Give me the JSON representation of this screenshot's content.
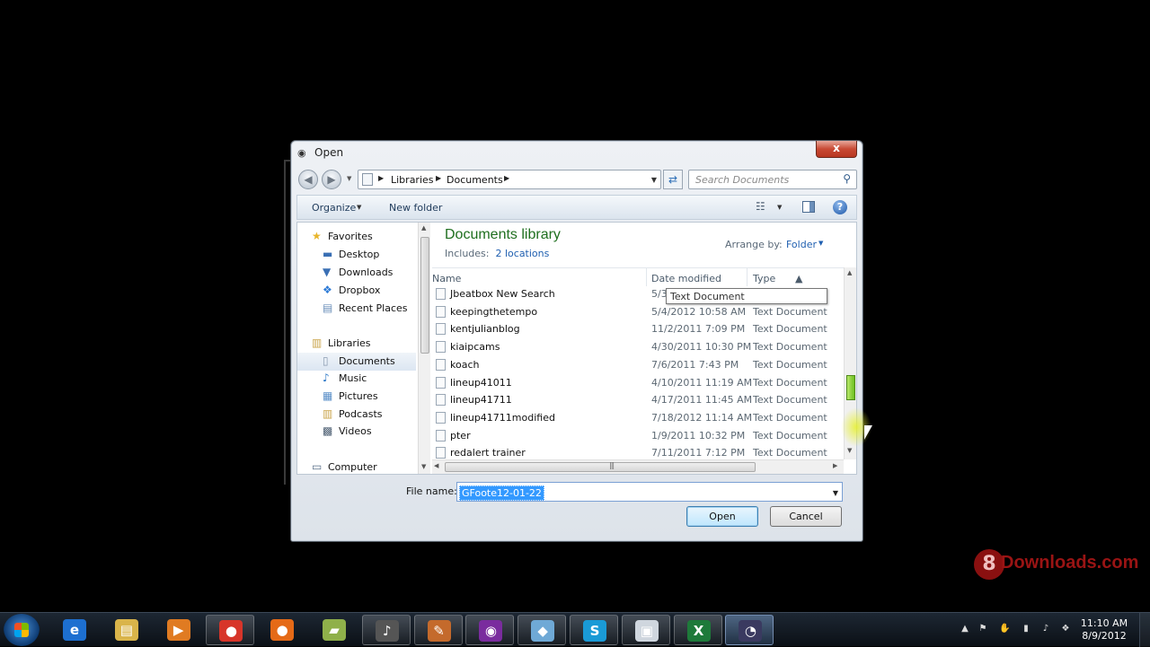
{
  "dialog": {
    "title": "Open",
    "close_label": "x",
    "nav": {
      "back_icon": "back-arrow-icon",
      "forward_icon": "forward-arrow-icon",
      "breadcrumb": [
        "Libraries",
        "Documents"
      ],
      "search_placeholder": "Search Documents"
    },
    "toolbar": {
      "organize_label": "Organize",
      "new_folder_label": "New folder"
    },
    "navpane": {
      "items": [
        {
          "label": "Favorites",
          "icon": "star-icon",
          "indent": 0,
          "selected": false
        },
        {
          "label": "Desktop",
          "icon": "desktop-icon",
          "indent": 1,
          "selected": false
        },
        {
          "label": "Downloads",
          "icon": "downloads-icon",
          "indent": 1,
          "selected": false
        },
        {
          "label": "Dropbox",
          "icon": "dropbox-icon",
          "indent": 1,
          "selected": false
        },
        {
          "label": "Recent Places",
          "icon": "recent-places-icon",
          "indent": 1,
          "selected": false
        },
        {
          "label": "Libraries",
          "icon": "libraries-icon",
          "indent": 0,
          "selected": false
        },
        {
          "label": "Documents",
          "icon": "documents-icon",
          "indent": 1,
          "selected": true
        },
        {
          "label": "Music",
          "icon": "music-icon",
          "indent": 1,
          "selected": false
        },
        {
          "label": "Pictures",
          "icon": "pictures-icon",
          "indent": 1,
          "selected": false
        },
        {
          "label": "Podcasts",
          "icon": "podcasts-icon",
          "indent": 1,
          "selected": false
        },
        {
          "label": "Videos",
          "icon": "videos-icon",
          "indent": 1,
          "selected": false
        },
        {
          "label": "Computer",
          "icon": "computer-icon",
          "indent": 0,
          "selected": false
        }
      ]
    },
    "library": {
      "title": "Documents library",
      "includes_label": "Includes:",
      "includes_link": "2 locations",
      "arrange_label": "Arrange by:",
      "arrange_value": "Folder"
    },
    "columns": {
      "name": "Name",
      "date": "Date modified",
      "type": "Type"
    },
    "files": [
      {
        "name": "Jbeatbox New Search",
        "date": "5/3",
        "type": ""
      },
      {
        "name": "keepingthetempo",
        "date": "5/4/2012 10:58 AM",
        "type": "Text Document"
      },
      {
        "name": "kentjulianblog",
        "date": "11/2/2011 7:09 PM",
        "type": "Text Document"
      },
      {
        "name": "kiaipcams",
        "date": "4/30/2011 10:30 PM",
        "type": "Text Document"
      },
      {
        "name": "koach",
        "date": "7/6/2011 7:43 PM",
        "type": "Text Document"
      },
      {
        "name": "lineup41011",
        "date": "4/10/2011 11:19 AM",
        "type": "Text Document"
      },
      {
        "name": "lineup41711",
        "date": "4/17/2011 11:45 AM",
        "type": "Text Document"
      },
      {
        "name": "lineup41711modified",
        "date": "7/18/2012 11:14 AM",
        "type": "Text Document"
      },
      {
        "name": "pter",
        "date": "1/9/2011 10:32 PM",
        "type": "Text Document"
      },
      {
        "name": "redalert trainer",
        "date": "7/11/2011 7:12 PM",
        "type": "Text Document"
      }
    ],
    "tooltip": "Text Document",
    "filename_label": "File name:",
    "filename_value": "GFoote12-01-22",
    "open_label": "Open",
    "cancel_label": "Cancel"
  },
  "watermark": {
    "digit": "8",
    "text": "Downloads.com"
  },
  "taskbar": {
    "apps": [
      {
        "name": "internet-explorer",
        "glyph": "e",
        "color": "#1d6fd0",
        "state": "none"
      },
      {
        "name": "windows-explorer",
        "glyph": "▤",
        "color": "#d9b44a",
        "state": "none"
      },
      {
        "name": "media-player",
        "glyph": "▶",
        "color": "#e07b22",
        "state": "none"
      },
      {
        "name": "chrome",
        "glyph": "●",
        "color": "#d7352a",
        "state": "open"
      },
      {
        "name": "firefox",
        "glyph": "●",
        "color": "#e56a17",
        "state": "none"
      },
      {
        "name": "notes-app",
        "glyph": "▰",
        "color": "#8fb04a",
        "state": "none"
      },
      {
        "name": "media-app",
        "glyph": "♪",
        "color": "#555",
        "state": "open"
      },
      {
        "name": "editor-app",
        "glyph": "✎",
        "color": "#c46a2c",
        "state": "open"
      },
      {
        "name": "torrent-app",
        "glyph": "◉",
        "color": "#7a2c9e",
        "state": "open"
      },
      {
        "name": "file-app",
        "glyph": "◆",
        "color": "#6fa9d6",
        "state": "open"
      },
      {
        "name": "skype",
        "glyph": "S",
        "color": "#1a9ad6",
        "state": "open"
      },
      {
        "name": "window-app",
        "glyph": "▣",
        "color": "#cfd6de",
        "state": "open"
      },
      {
        "name": "excel",
        "glyph": "X",
        "color": "#1e7a3a",
        "state": "open"
      },
      {
        "name": "audio-app",
        "glyph": "◔",
        "color": "#3a3a60",
        "state": "active"
      }
    ],
    "clock_time": "11:10 AM",
    "clock_date": "8/9/2012"
  }
}
